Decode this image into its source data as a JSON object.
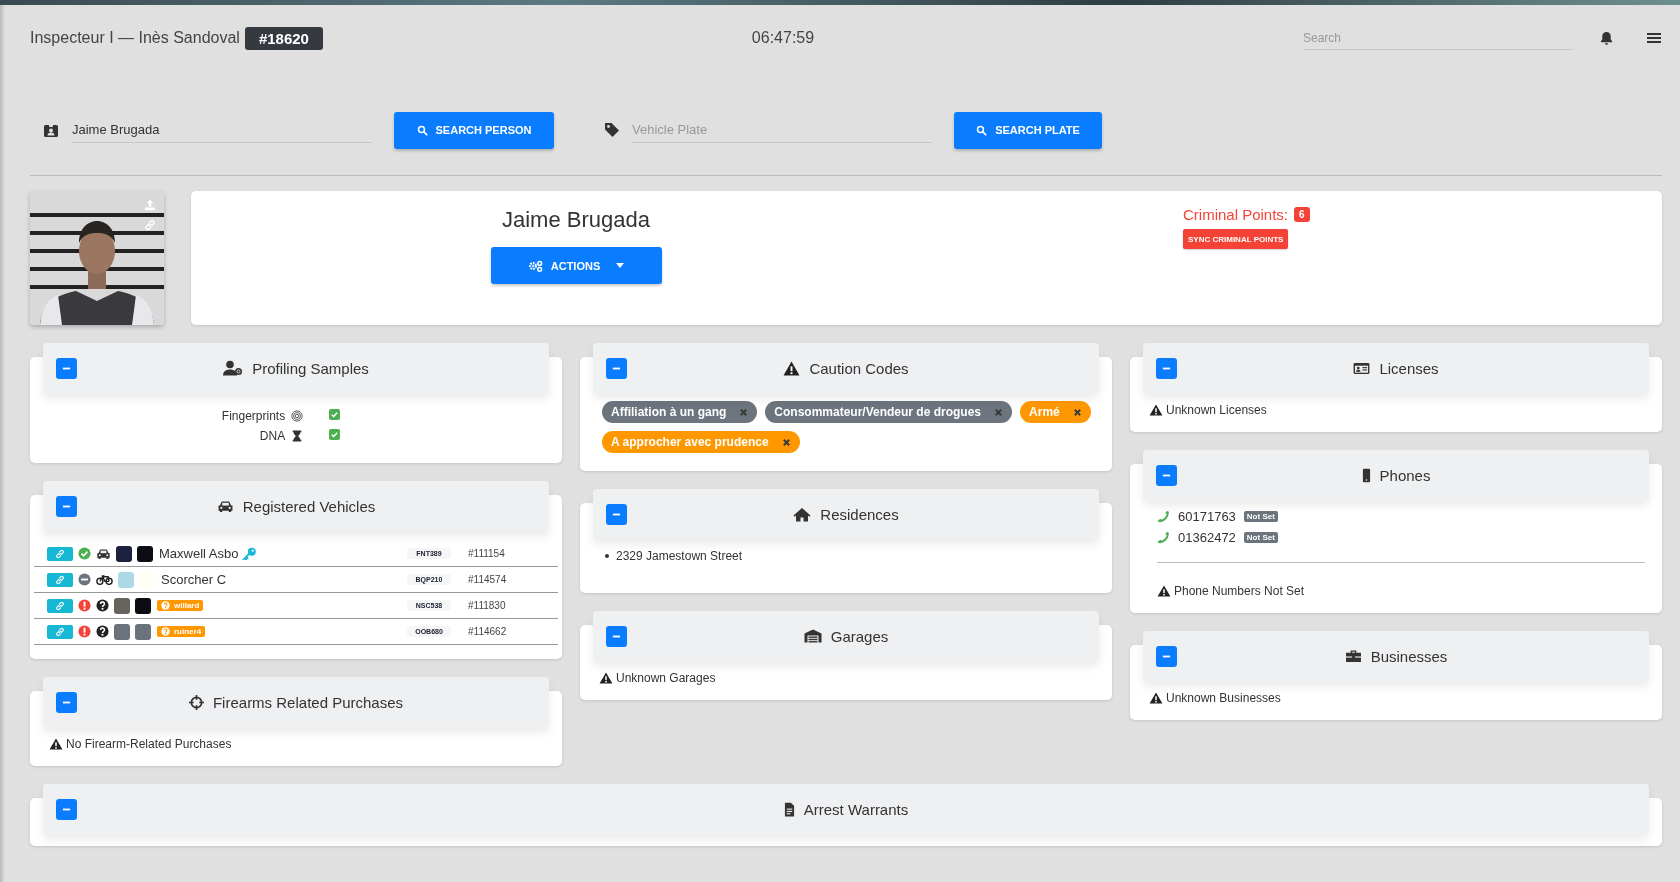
{
  "header": {
    "title": "Inspecteur I — Inès Sandoval",
    "badge": "#18620",
    "clock": "06:47:59",
    "search_placeholder": "Search"
  },
  "search": {
    "person": {
      "value": "Jaime Brugada",
      "button": "SEARCH PERSON"
    },
    "plate": {
      "placeholder": "Vehicle Plate",
      "button": "SEARCH PLATE"
    }
  },
  "profile": {
    "name": "Jaime Brugada",
    "actions_button": "ACTIONS",
    "criminal_points_label": "Criminal Points:",
    "criminal_points": "6",
    "sync_button": "SYNC CRIMINAL POINTS"
  },
  "columns": [
    {
      "panels": [
        {
          "kind": "samples",
          "title": "Profiling Samples",
          "expanded": true,
          "items": [
            {
              "label": "Fingerprints",
              "checked": true
            },
            {
              "label": "DNA",
              "checked": true
            }
          ]
        },
        {
          "kind": "vehicles",
          "title": "Registered Vehicles",
          "expanded": true,
          "rows": [
            {
              "markers": [
                {
                  "kind": "ok"
                },
                {
                  "kind": "car"
                }
              ],
              "swatches": [
                {
                  "color": "#1c2140"
                },
                {
                  "color": "#0b0d12"
                }
              ],
              "owner": "Maxwell Asbo",
              "key": true,
              "plate": "FNT389",
              "id": "#111154"
            },
            {
              "markers": [
                {
                  "kind": "none"
                },
                {
                  "kind": "bike"
                }
              ],
              "swatches": [
                {
                  "color": "#add8e6"
                },
                {
                  "color": "#fffff5"
                }
              ],
              "owner": "Scorcher C",
              "key": false,
              "plate": "BQP210",
              "id": "#114574"
            },
            {
              "markers": [
                {
                  "kind": "alert"
                },
                {
                  "kind": "unknown"
                }
              ],
              "swatches": [
                {
                  "color": "#66645c"
                },
                {
                  "color": "#0b0d12"
                }
              ],
              "model": "willard",
              "key": false,
              "plate": "NSC538",
              "id": "#111830"
            },
            {
              "markers": [
                {
                  "kind": "alert"
                },
                {
                  "kind": "unknown"
                }
              ],
              "swatches": [
                {
                  "color": "#6a737b"
                },
                {
                  "color": "#6a737b"
                }
              ],
              "model": "ruiner4",
              "key": false,
              "plate": "OOB680",
              "id": "#114662"
            }
          ]
        },
        {
          "kind": "notice",
          "title": "Firearms Related Purchases",
          "expanded": true,
          "notice": "No Firearm-Related Purchases"
        }
      ]
    },
    {
      "panels": [
        {
          "kind": "tags",
          "title": "Caution Codes",
          "expanded": true,
          "tags": [
            {
              "label": "Affiliation à un gang",
              "color": "#6c757d"
            },
            {
              "label": "Consommateur/Vendeur de drogues",
              "color": "#6c757d"
            },
            {
              "label": "Armé",
              "color": "#ff9800"
            },
            {
              "label": "A approcher avec prudence",
              "color": "#ff9800"
            }
          ]
        },
        {
          "kind": "list",
          "title": "Residences",
          "expanded": true,
          "items": [
            "2329 Jamestown Street"
          ]
        },
        {
          "kind": "notice",
          "title": "Garages",
          "expanded": true,
          "notice": "Unknown Garages"
        }
      ]
    },
    {
      "panels": [
        {
          "kind": "notice",
          "title": "Licenses",
          "expanded": true,
          "notice": "Unknown Licenses"
        },
        {
          "kind": "phones",
          "title": "Phones",
          "expanded": true,
          "numbers": [
            {
              "number": "60171763",
              "badge": "Not Set"
            },
            {
              "number": "01362472",
              "badge": "Not Set"
            }
          ],
          "notice": "Phone Numbers Not Set"
        },
        {
          "kind": "notice",
          "title": "Businesses",
          "expanded": true,
          "notice": "Unknown Businesses"
        }
      ]
    }
  ],
  "wide_panels": [
    {
      "title": "Arrest Warrants",
      "expanded": true
    }
  ]
}
